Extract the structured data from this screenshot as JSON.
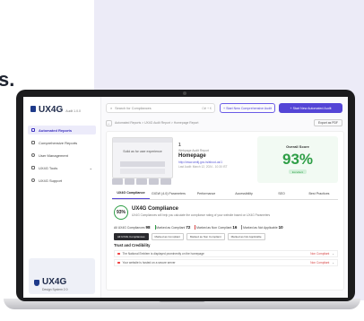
{
  "colors": {
    "accent": "#5445d6",
    "success": "#2e9e46",
    "danger": "#d64545",
    "background": "#ecebf7"
  },
  "headline_fragment": "s.",
  "app": {
    "logo": "UX4G",
    "logo_sub": "Audit 1.0.0"
  },
  "sidebar": {
    "items": [
      {
        "label": "Automated Reports",
        "icon": "report-icon",
        "active": true
      },
      {
        "label": "Comprehensive Reports",
        "icon": "document-icon",
        "active": false
      },
      {
        "label": "User Management",
        "icon": "user-icon",
        "active": false
      },
      {
        "label": "UX4G Tools",
        "icon": "tools-icon",
        "active": false
      },
      {
        "label": "UX4G Support",
        "icon": "support-icon",
        "active": false
      }
    ],
    "promo": {
      "logo": "UX4G",
      "sub": "Design System 2.0"
    }
  },
  "topbar": {
    "search_placeholder": "Search for Compliances",
    "search_shortcut": "Ctrl + K",
    "comprehensive_button": "+ Start New Comprehensive Audit",
    "automated_button": "+ Start New Automated Audit"
  },
  "breadcrumb": {
    "text": "Automated Reports  >  UX4G Audit Report  >  Homepage Report",
    "export": "Export as PDF"
  },
  "page": {
    "number": "1",
    "label": "Webpage Audit Report",
    "title": "Homepage",
    "url": "http://www.amitj.gov.in/about-us/1",
    "date": "Last Audit: March 12, 2024 - 10:30 IST",
    "thumb_title": "Solid as for user experience"
  },
  "score": {
    "label": "Overall Score",
    "value": "93%",
    "badge": "Excellent",
    "fraction": 0.93
  },
  "tabs": [
    {
      "label": "UX4G Compliance",
      "active": true
    },
    {
      "label": "GIGW (4.0) Parameters",
      "active": false
    },
    {
      "label": "Performance",
      "active": false
    },
    {
      "label": "Accessibility",
      "active": false
    },
    {
      "label": "SEO",
      "active": false
    },
    {
      "label": "Best Practices",
      "active": false
    }
  ],
  "compliance": {
    "ring": "93%",
    "title": "UX4G Compliance",
    "desc": "UX4G Compliances will help you calculate the compliance rating of your website based on UX4G Parameters",
    "counts": [
      {
        "label": "All UX4G Compliances",
        "value": "98",
        "color": "#999999"
      },
      {
        "label": "Marked as Compliant",
        "value": "72",
        "color": "#2e9e46"
      },
      {
        "label": "Marked as Non Compliant",
        "value": "16",
        "color": "#d64545"
      },
      {
        "label": "Marked as Not Applicable",
        "value": "10",
        "color": "#888888"
      }
    ],
    "filters": [
      "All UX4G Compliances",
      "Marked as Compliant",
      "Marked as Non Compliant",
      "Marked as Not Applicable"
    ]
  },
  "section": {
    "title": "Trust and Credibility",
    "rows": [
      {
        "text": "The National Emblem is displayed prominently on the homepage",
        "status": "Non Compliant"
      },
      {
        "text": "Your website is hosted on a secure server",
        "status": "Non Compliant"
      }
    ]
  }
}
